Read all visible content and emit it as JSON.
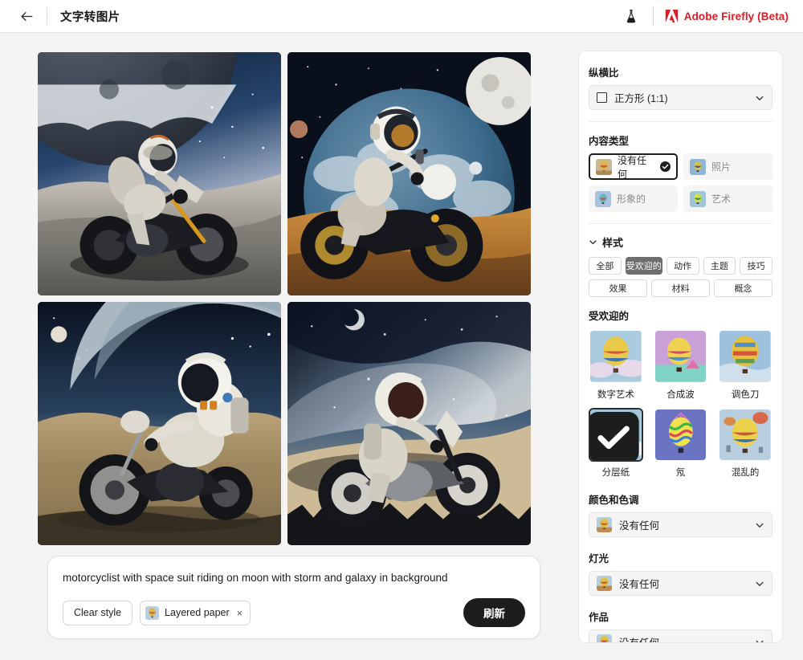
{
  "header": {
    "back_icon": "arrow-left-icon",
    "title": "文字转图片",
    "lab_icon": "flask-icon",
    "brand_icon": "adobe-logo-icon",
    "brand_text": "Adobe Firefly (Beta)"
  },
  "results": {
    "tiles": [
      {
        "alt": "astronaut motorcyclist riding on moon surface with giant cratered planet in dark blue starry sky"
      },
      {
        "alt": "astronaut on motorcycle with blue cloud-covered planet and moon over orange terrain"
      },
      {
        "alt": "astronaut on motorcycle facing left on tan desert terrain with crescent planet"
      },
      {
        "alt": "astronaut on motorcycle against Milky Way galaxy with dark rocky foreground"
      }
    ]
  },
  "prompt": {
    "text": "motorcyclist with space suit riding on moon with storm and galaxy in background",
    "clear_style_label": "Clear style",
    "style_chip": {
      "label": "Layered paper",
      "remove_icon": "close-icon"
    },
    "refresh_label": "刷新"
  },
  "panel": {
    "aspect_ratio": {
      "label": "纵横比",
      "value": "正方形 (1:1)",
      "icon": "square-icon",
      "chevron": "chevron-down-icon"
    },
    "content_type": {
      "label": "内容类型",
      "options": [
        {
          "label": "没有任何",
          "selected": true
        },
        {
          "label": "照片",
          "selected": false
        },
        {
          "label": "形象的",
          "selected": false
        },
        {
          "label": "艺术",
          "selected": false
        }
      ],
      "check_icon": "check-circle-icon"
    },
    "style": {
      "label": "样式",
      "caret_icon": "chevron-down-icon",
      "filters_row1": [
        {
          "label": "全部",
          "active": false
        },
        {
          "label": "受欢迎的",
          "active": true
        },
        {
          "label": "动作",
          "active": false
        },
        {
          "label": "主题",
          "active": false
        },
        {
          "label": "技巧",
          "active": false
        }
      ],
      "filters_row2": [
        {
          "label": "效果",
          "active": false
        },
        {
          "label": "材料",
          "active": false
        },
        {
          "label": "概念",
          "active": false
        }
      ],
      "group_label": "受欢迎的",
      "items": [
        {
          "label": "数字艺术",
          "selected": false
        },
        {
          "label": "合成波",
          "selected": false
        },
        {
          "label": "调色刀",
          "selected": false
        },
        {
          "label": "分层纸",
          "selected": true
        },
        {
          "label": "氖",
          "selected": false
        },
        {
          "label": "混乱的",
          "selected": false
        }
      ]
    },
    "color_tone": {
      "label": "颜色和色调",
      "value": "没有任何",
      "chevron": "chevron-down-icon"
    },
    "lighting": {
      "label": "灯光",
      "value": "没有任何",
      "chevron": "chevron-down-icon"
    },
    "composition": {
      "label": "作品",
      "value": "没有任何",
      "chevron": "chevron-down-icon"
    }
  },
  "colors": {
    "brand_red": "#e01b24",
    "accent_dark": "#1d1d1d",
    "chip_active": "#6e6e6e",
    "page_bg": "#f4f4f4"
  }
}
